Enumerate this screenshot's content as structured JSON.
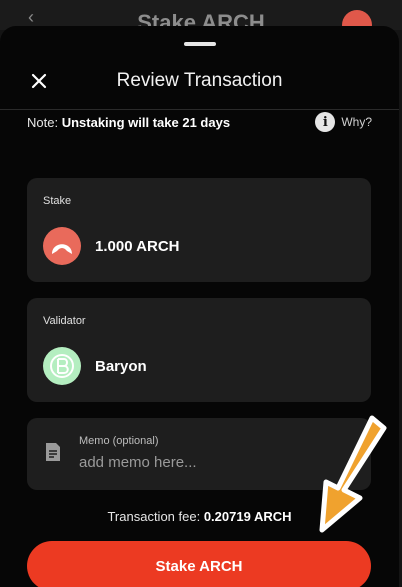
{
  "background": {
    "title": "Stake ARCH"
  },
  "sheet": {
    "title": "Review Transaction",
    "note_prefix": "Note:",
    "note_text": "Unstaking will take 21 days",
    "why_label": "Why?"
  },
  "stake": {
    "label": "Stake",
    "amount": "1.000 ARCH"
  },
  "validator": {
    "label": "Validator",
    "name": "Baryon"
  },
  "memo": {
    "label": "Memo (optional)",
    "placeholder": "add memo here..."
  },
  "fee": {
    "label": "Transaction fee:",
    "value": "0.20719 ARCH"
  },
  "action": {
    "button_label": "Stake ARCH"
  },
  "icons": {
    "close": "close-icon",
    "info": "info-icon",
    "memo": "document-icon",
    "annotation": "arrow-icon"
  },
  "colors": {
    "accent": "#ec3a22",
    "arch_logo": "#e96a5b",
    "validator_logo": "#b4eec0",
    "annotation_arrow": "#f0a22e"
  }
}
